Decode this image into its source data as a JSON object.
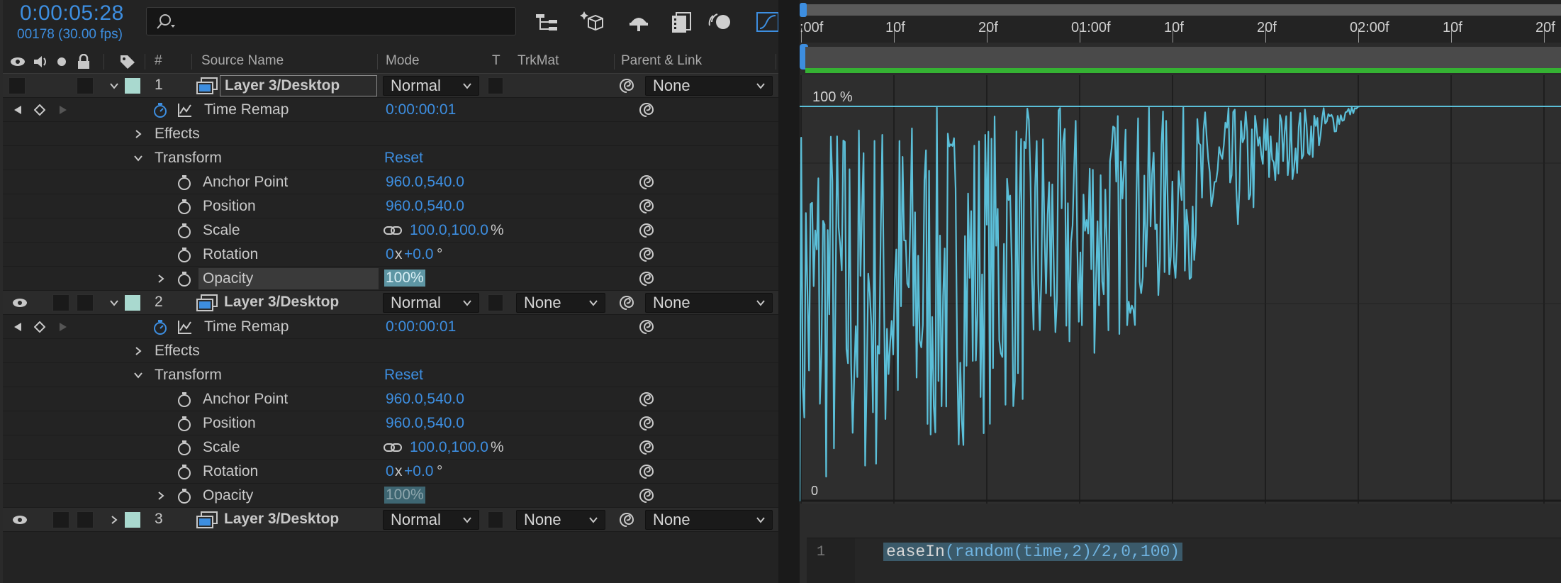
{
  "toolbar": {
    "timecode": "0:00:05:28",
    "fps": "00178 (30.00 fps)",
    "search_placeholder": ""
  },
  "columns": {
    "number": "#",
    "source_name": "Source Name",
    "mode": "Mode",
    "t": "T",
    "trkmat": "TrkMat",
    "parent_link": "Parent & Link"
  },
  "layers": [
    {
      "number": "1",
      "name": "Layer 3/Desktop",
      "mode": "Normal",
      "trkmat": "",
      "parent": "None",
      "expanded": true,
      "time_remap": {
        "label": "Time Remap",
        "value": "0:00:00:01"
      },
      "effects_label": "Effects",
      "transform": {
        "label": "Transform",
        "reset": "Reset",
        "anchor_point": {
          "label": "Anchor Point",
          "value": "960.0,540.0"
        },
        "position": {
          "label": "Position",
          "value": "960.0,540.0"
        },
        "scale": {
          "label": "Scale",
          "value": "100.0,100.0",
          "unit": "%"
        },
        "rotation": {
          "label": "Rotation",
          "value_x": "0",
          "x": "x",
          "value_deg": "+0.0",
          "unit": "°"
        },
        "opacity": {
          "label": "Opacity",
          "value": "100%"
        }
      }
    },
    {
      "number": "2",
      "name": "Layer 3/Desktop",
      "mode": "Normal",
      "trkmat": "None",
      "parent": "None",
      "expanded": true,
      "time_remap": {
        "label": "Time Remap",
        "value": "0:00:00:01"
      },
      "effects_label": "Effects",
      "transform": {
        "label": "Transform",
        "reset": "Reset",
        "anchor_point": {
          "label": "Anchor Point",
          "value": "960.0,540.0"
        },
        "position": {
          "label": "Position",
          "value": "960.0,540.0"
        },
        "scale": {
          "label": "Scale",
          "value": "100.0,100.0",
          "unit": "%"
        },
        "rotation": {
          "label": "Rotation",
          "value_x": "0",
          "x": "x",
          "value_deg": "+0.0",
          "unit": "°"
        },
        "opacity": {
          "label": "Opacity",
          "value": "100%"
        }
      }
    },
    {
      "number": "3",
      "name": "Layer 3/Desktop",
      "mode": "Normal",
      "trkmat": "None",
      "parent": "None",
      "expanded": false
    }
  ],
  "ruler": {
    "labels": [
      ":00f",
      "10f",
      "20f",
      "01:00f",
      "10f",
      "20f",
      "02:00f",
      "10f",
      "20f"
    ]
  },
  "graph": {
    "top_label": "100 %",
    "bottom_label": "0"
  },
  "expression": {
    "line_number": "1",
    "code_fn1": "easeIn",
    "code_p1": "(",
    "code_fn2": "random",
    "code_args": "(time,2)/2,0,100)"
  },
  "colors": {
    "accent_blue": "#3d8ee0",
    "layer_label": "#a9d9cf",
    "graph_curve": "#5bbfd8",
    "green_bar": "#35b233"
  }
}
